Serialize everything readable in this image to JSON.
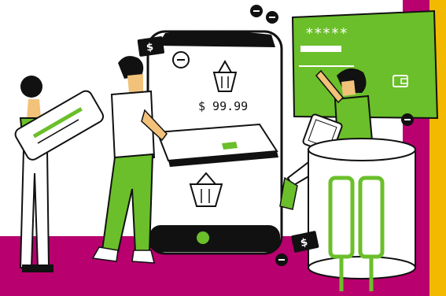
{
  "phone": {
    "price_text": "$ 99.99"
  },
  "card": {
    "masked_number": "*****"
  },
  "money_tags": {
    "symbol": "$"
  },
  "palette": {
    "magenta": "#B8006E",
    "gold": "#F2B900",
    "green": "#6BBF2A",
    "green_dark": "#4E9A1C",
    "ink": "#111111",
    "skin": "#F2C27A",
    "paper": "#FFFFFF"
  },
  "icons": [
    "minus-badge-icon",
    "shopping-basket-icon",
    "dollar-tag-icon",
    "wallet-icon",
    "crutches-icon"
  ]
}
